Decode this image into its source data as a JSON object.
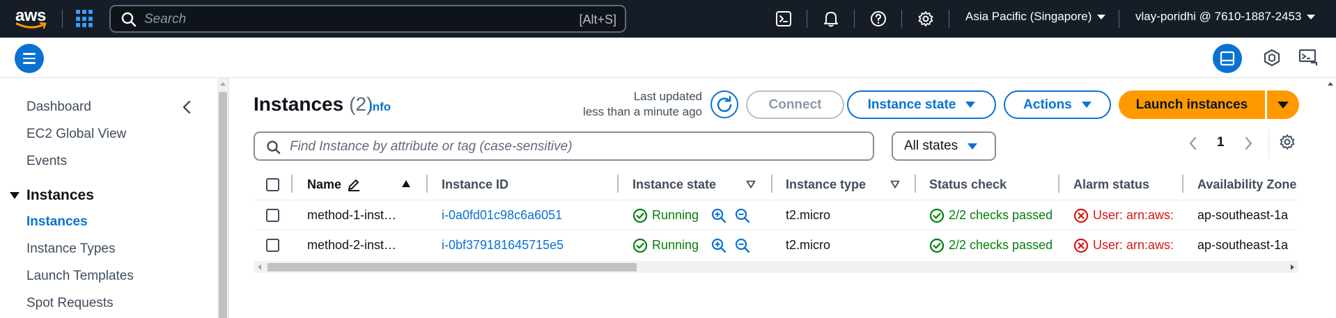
{
  "topnav": {
    "logo": "aws",
    "search_placeholder": "Search",
    "search_shortcut": "[Alt+S]",
    "region": "Asia Pacific (Singapore)",
    "account": "vlay-poridhi @ 7610-1887-2453",
    "icons": [
      "cloudshell-icon",
      "bell-icon",
      "help-icon",
      "gear-icon"
    ]
  },
  "sidebar": {
    "items": [
      {
        "label": "Dashboard"
      },
      {
        "label": "EC2 Global View"
      },
      {
        "label": "Events"
      }
    ],
    "section": {
      "label": "Instances"
    },
    "section_items": [
      {
        "label": "Instances",
        "active": true
      },
      {
        "label": "Instance Types"
      },
      {
        "label": "Launch Templates"
      },
      {
        "label": "Spot Requests"
      }
    ]
  },
  "main": {
    "title": "Instances",
    "count": "(2)",
    "info": "Info",
    "last_updated_line1": "Last updated",
    "last_updated_line2": "less than a minute ago",
    "connect_label": "Connect",
    "instance_state_label": "Instance state",
    "actions_label": "Actions",
    "launch_label": "Launch instances",
    "filter_placeholder": "Find Instance by attribute or tag (case-sensitive)",
    "states_filter": "All states",
    "page_number": "1"
  },
  "table": {
    "columns": [
      "Name",
      "Instance ID",
      "Instance state",
      "Instance type",
      "Status check",
      "Alarm status",
      "Availability Zone"
    ],
    "rows": [
      {
        "name": "method-1-inst…",
        "id": "i-0a0fd01c98c6a6051",
        "state": "Running",
        "type": "t2.micro",
        "status": "2/2 checks passed",
        "alarm": "User: arn:aws:",
        "az": "ap-southeast-1a"
      },
      {
        "name": "method-2-inst…",
        "id": "i-0bf379181645715e5",
        "state": "Running",
        "type": "t2.micro",
        "status": "2/2 checks passed",
        "alarm": "User: arn:aws:",
        "az": "ap-southeast-1a"
      }
    ]
  },
  "colors": {
    "nav_bg": "#161d26",
    "accent": "#0972d3",
    "launch": "#ff9900",
    "success": "#037f0c",
    "error": "#d91515"
  }
}
